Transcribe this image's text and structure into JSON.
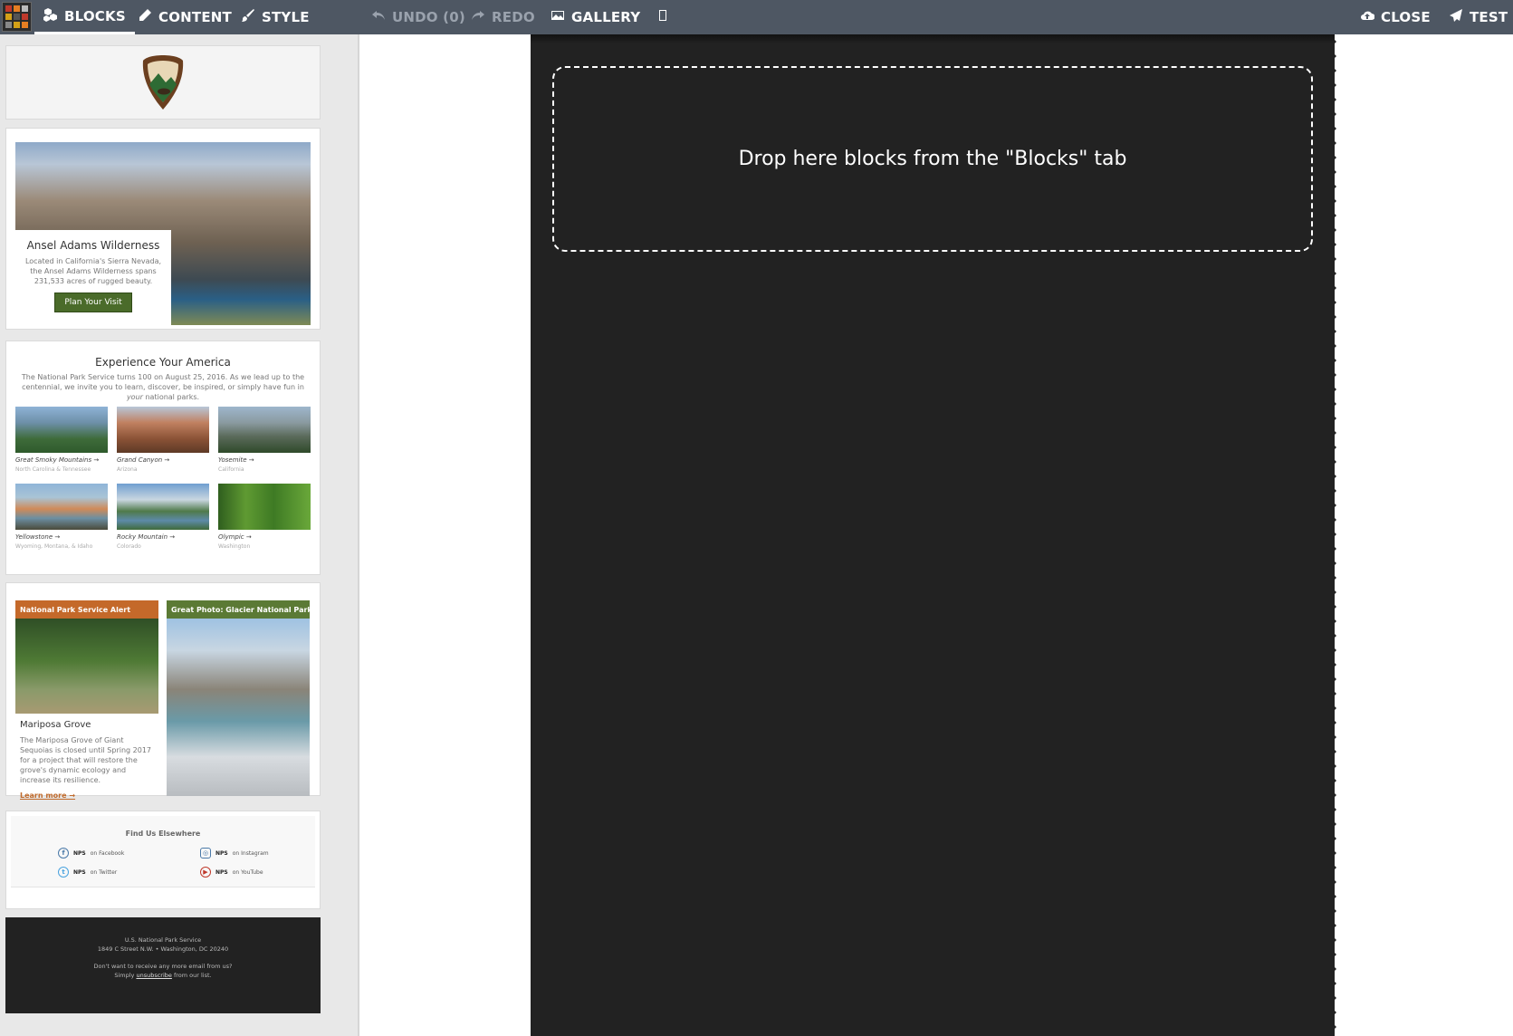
{
  "toolbar": {
    "blocks": "BLOCKS",
    "content": "CONTENT",
    "style": "STYLE",
    "undo": "UNDO (0)",
    "redo": "REDO",
    "gallery": "GALLERY",
    "close": "CLOSE",
    "test": "TEST",
    "icons": [
      "cubes-icon",
      "pencil-icon",
      "brush-icon",
      "undo-icon",
      "redo-icon",
      "image-icon",
      "mobile-icon",
      "cloud-upload-icon",
      "paper-plane-icon"
    ]
  },
  "blocks": {
    "hero": {
      "title": "Ansel Adams Wilderness",
      "desc": "Located in California's Sierra Nevada, the Ansel Adams Wilderness spans 231,533 acres of rugged beauty.",
      "button": "Plan Your Visit"
    },
    "parks": {
      "title": "Experience Your America",
      "desc_prefix": "The National Park Service turns 100 on August 25, 2016. As we lead up to the centennial, we invite you to learn, discover, be inspired, or simply have fun in ",
      "desc_em": "your",
      "desc_suffix": " national parks.",
      "items": [
        {
          "name": "Great Smoky Mountains →",
          "loc": "North Carolina & Tennessee",
          "color": "#5f86a8"
        },
        {
          "name": "Grand Canyon →",
          "loc": "Arizona",
          "color": "#a06a48"
        },
        {
          "name": "Yosemite →",
          "loc": "California",
          "color": "#6a7f86"
        },
        {
          "name": "Yellowstone →",
          "loc": "Wyoming, Montana, & Idaho",
          "color": "#9a7d6a"
        },
        {
          "name": "Rocky Mountain →",
          "loc": "Colorado",
          "color": "#6c8fa6"
        },
        {
          "name": "Olympic →",
          "loc": "Washington",
          "color": "#3f7f2a"
        }
      ]
    },
    "alert": {
      "bar": "National Park Service Alert",
      "bar_color": "#c4692a",
      "title": "Mariposa Grove",
      "desc": "The Mariposa Grove of Giant Sequoias is closed until Spring 2017 for a project that will restore the grove's dynamic ecology and increase its resilience.",
      "link": "Learn more →"
    },
    "photo": {
      "bar": "Great Photo: Glacier National Park",
      "bar_color": "#5b7a35"
    },
    "social": {
      "title": "Find Us Elsewhere",
      "brand": "NPS",
      "facebook": "on Facebook",
      "instagram": "on Instagram",
      "twitter": "on Twitter",
      "youtube": "on YouTube"
    },
    "footer": {
      "org": "U.S. National Park Service",
      "address": "1849 C Street N.W. • Washington, DC 20240",
      "line1": "Don't want to receive any more email from us?",
      "simply": "Simply ",
      "unsubscribe": "unsubscribe",
      "after": " from our list."
    }
  },
  "canvas": {
    "drop_text": "Drop here blocks from the \"Blocks\" tab",
    "bg": "#222222"
  }
}
